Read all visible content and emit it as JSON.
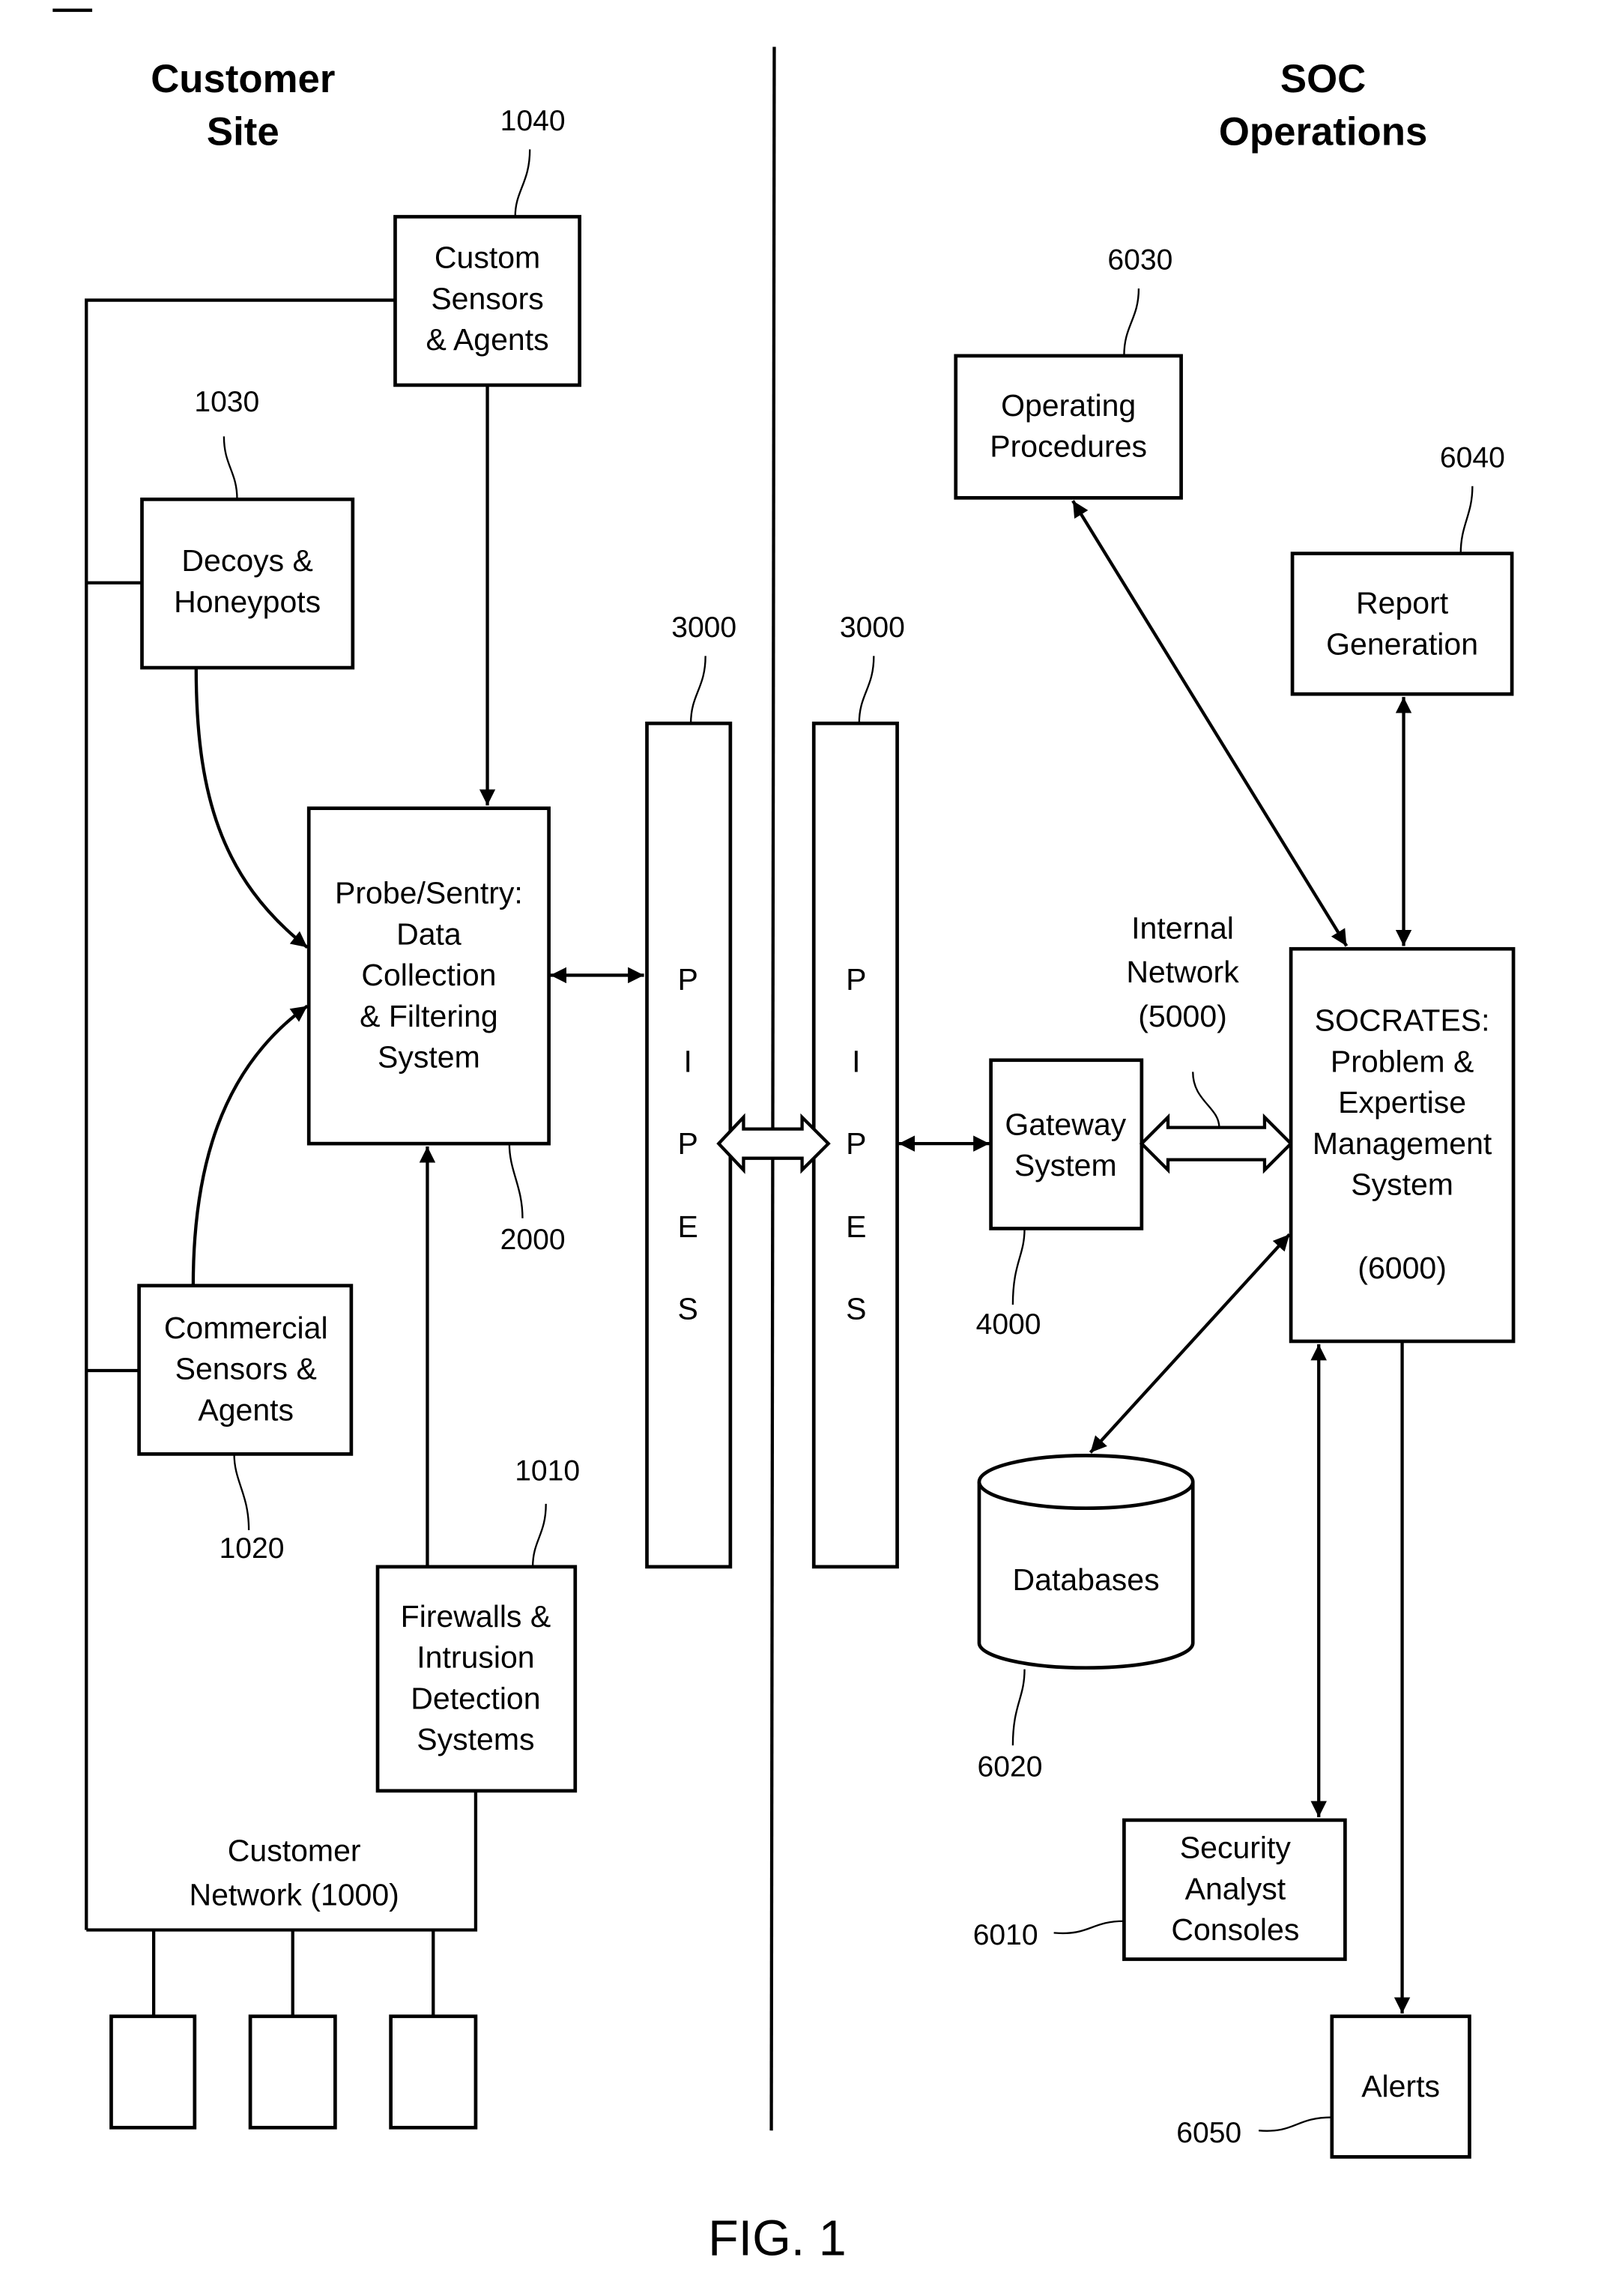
{
  "figure": {
    "caption": "FIG. 1",
    "headers": {
      "customer_site": [
        "Customer",
        "Site"
      ],
      "soc_operations": [
        "SOC",
        "Operations"
      ]
    }
  },
  "customer_site": {
    "custom_sensors": {
      "lines": [
        "Custom",
        "Sensors",
        "& Agents"
      ],
      "ref": "1040"
    },
    "decoys": {
      "lines": [
        "Decoys &",
        "Honeypots"
      ],
      "ref": "1030"
    },
    "probe": {
      "lines": [
        "Probe/Sentry:",
        "Data",
        "Collection",
        "& Filtering",
        "System"
      ],
      "ref": "2000"
    },
    "commercial_sensors": {
      "lines": [
        "Commercial",
        "Sensors &",
        "Agents"
      ],
      "ref": "1020"
    },
    "firewalls": {
      "lines": [
        "Firewalls &",
        "Intrusion",
        "Detection",
        "Systems"
      ],
      "ref": "1010"
    },
    "customer_network": {
      "lines": [
        "Customer",
        "Network (1000)"
      ]
    },
    "endpoints_count": 3
  },
  "pipes": {
    "left": {
      "letters": [
        "P",
        "I",
        "P",
        "E",
        "S"
      ],
      "ref": "3000"
    },
    "right": {
      "letters": [
        "P",
        "I",
        "P",
        "E",
        "S"
      ],
      "ref": "3000"
    }
  },
  "soc": {
    "operating_procedures": {
      "lines": [
        "Operating",
        "Procedures"
      ],
      "ref": "6030"
    },
    "report_generation": {
      "lines": [
        "Report",
        "Generation"
      ],
      "ref": "6040"
    },
    "gateway": {
      "lines": [
        "Gateway",
        "System"
      ],
      "ref": "4000"
    },
    "internal_network": {
      "lines": [
        "Internal",
        "Network",
        "(5000)"
      ]
    },
    "socrates": {
      "lines": [
        "SOCRATES:",
        "Problem &",
        "Expertise",
        "Management",
        "System",
        "",
        "(6000)"
      ]
    },
    "databases": {
      "lines": [
        "Databases"
      ],
      "ref": "6020"
    },
    "consoles": {
      "lines": [
        "Security",
        "Analyst",
        "Consoles"
      ],
      "ref": "6010"
    },
    "alerts": {
      "lines": [
        "Alerts"
      ],
      "ref": "6050"
    }
  }
}
